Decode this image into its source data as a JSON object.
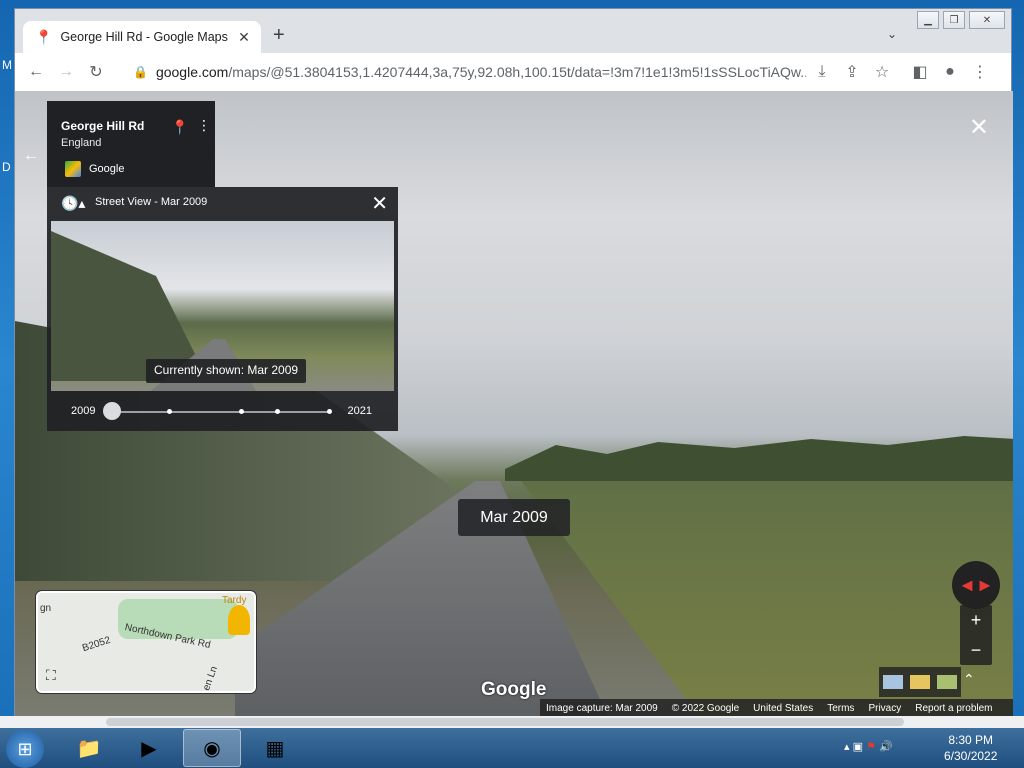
{
  "desktop": {
    "frag_top": "M",
    "frag_mid": "D"
  },
  "browser": {
    "tab_title": "George Hill Rd - Google Maps",
    "url_host": "google.com",
    "url_path": "/maps/@51.3804153,1.4207444,3a,75y,92.08h,100.15t/data=!3m7!1e1!3m5!1sSSLocTiAQw..."
  },
  "icons": {
    "maps_favicon": "maps-pin-icon",
    "close": "close-icon",
    "new_tab": "plus-icon",
    "back": "arrow-left-icon",
    "forward": "arrow-right-icon",
    "reload": "reload-icon",
    "lock": "lock-icon",
    "download": "download-icon",
    "share": "share-icon",
    "star": "star-icon",
    "sidepanel": "sidepanel-icon",
    "profile": "profile-icon",
    "menu": "kebab-menu-icon"
  },
  "infocard": {
    "title": "George Hill Rd",
    "subtitle": "England",
    "source": "Google"
  },
  "timepanel": {
    "title": "Street View - Mar 2009",
    "tooltip": "Currently shown: Mar 2009",
    "year_start": "2009",
    "year_end": "2021"
  },
  "scene": {
    "date_chip": "Mar 2009",
    "logo": "Google"
  },
  "minimap": {
    "road1": "B2052",
    "road2": "Northdown Park Rd",
    "road3": "Tardy",
    "road4": "gn",
    "road5": "en Ln"
  },
  "footer": {
    "capture": "Image capture: Mar 2009",
    "copyright": "© 2022 Google",
    "country": "United States",
    "terms": "Terms",
    "privacy": "Privacy",
    "report": "Report a problem"
  },
  "taskbar": {
    "time": "8:30 PM",
    "date": "6/30/2022"
  },
  "colors": {
    "accent": "#1a73e8",
    "panel_bg": "#202124",
    "taskbar": "#1f4f7f"
  }
}
